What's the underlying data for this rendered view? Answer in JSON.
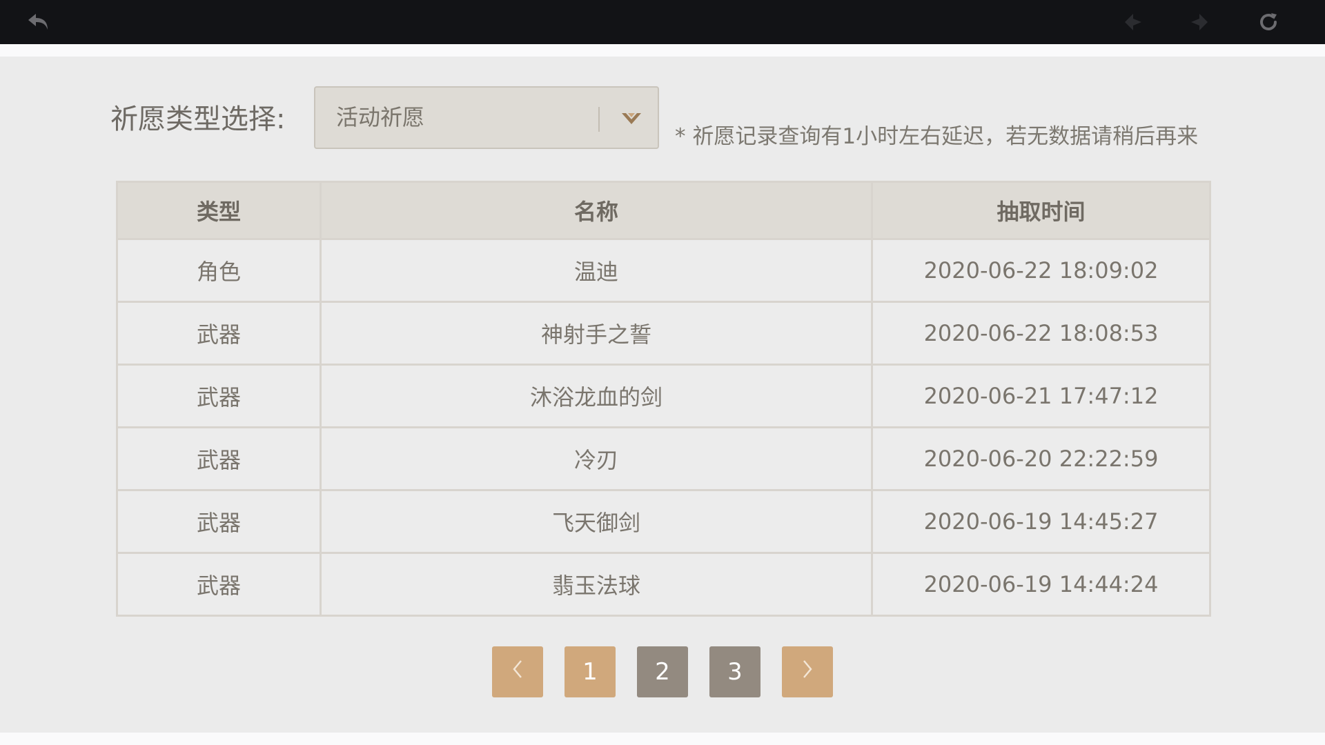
{
  "nav": {
    "back_icon": "undo-arrow-icon",
    "prev_icon": "diamond-left-icon",
    "next_icon": "diamond-right-icon",
    "refresh_icon": "refresh-icon"
  },
  "filter": {
    "label": "祈愿类型选择:",
    "selected": "活动祈愿",
    "dropdown_icon": "chevron-down-icon"
  },
  "notice": "* 祈愿记录查询有1小时左右延迟，若无数据请稍后再来",
  "table": {
    "headers": [
      "类型",
      "名称",
      "抽取时间"
    ],
    "rows": [
      {
        "type": "角色",
        "name": "温迪",
        "time": "2020-06-22 18:09:02"
      },
      {
        "type": "武器",
        "name": "神射手之誓",
        "time": "2020-06-22 18:08:53"
      },
      {
        "type": "武器",
        "name": "沐浴龙血的剑",
        "time": "2020-06-21 17:47:12"
      },
      {
        "type": "武器",
        "name": "冷刃",
        "time": "2020-06-20 22:22:59"
      },
      {
        "type": "武器",
        "name": "飞天御剑",
        "time": "2020-06-19 14:45:27"
      },
      {
        "type": "武器",
        "name": "翡玉法球",
        "time": "2020-06-19 14:44:24"
      }
    ]
  },
  "pagination": {
    "pages": [
      "1",
      "2",
      "3"
    ],
    "current": "1",
    "prev_icon": "chevron-left-icon",
    "next_icon": "chevron-right-icon"
  },
  "colors": {
    "accent": "#d0a87c",
    "inactive_page": "#938a80",
    "topbar": "#121316"
  }
}
